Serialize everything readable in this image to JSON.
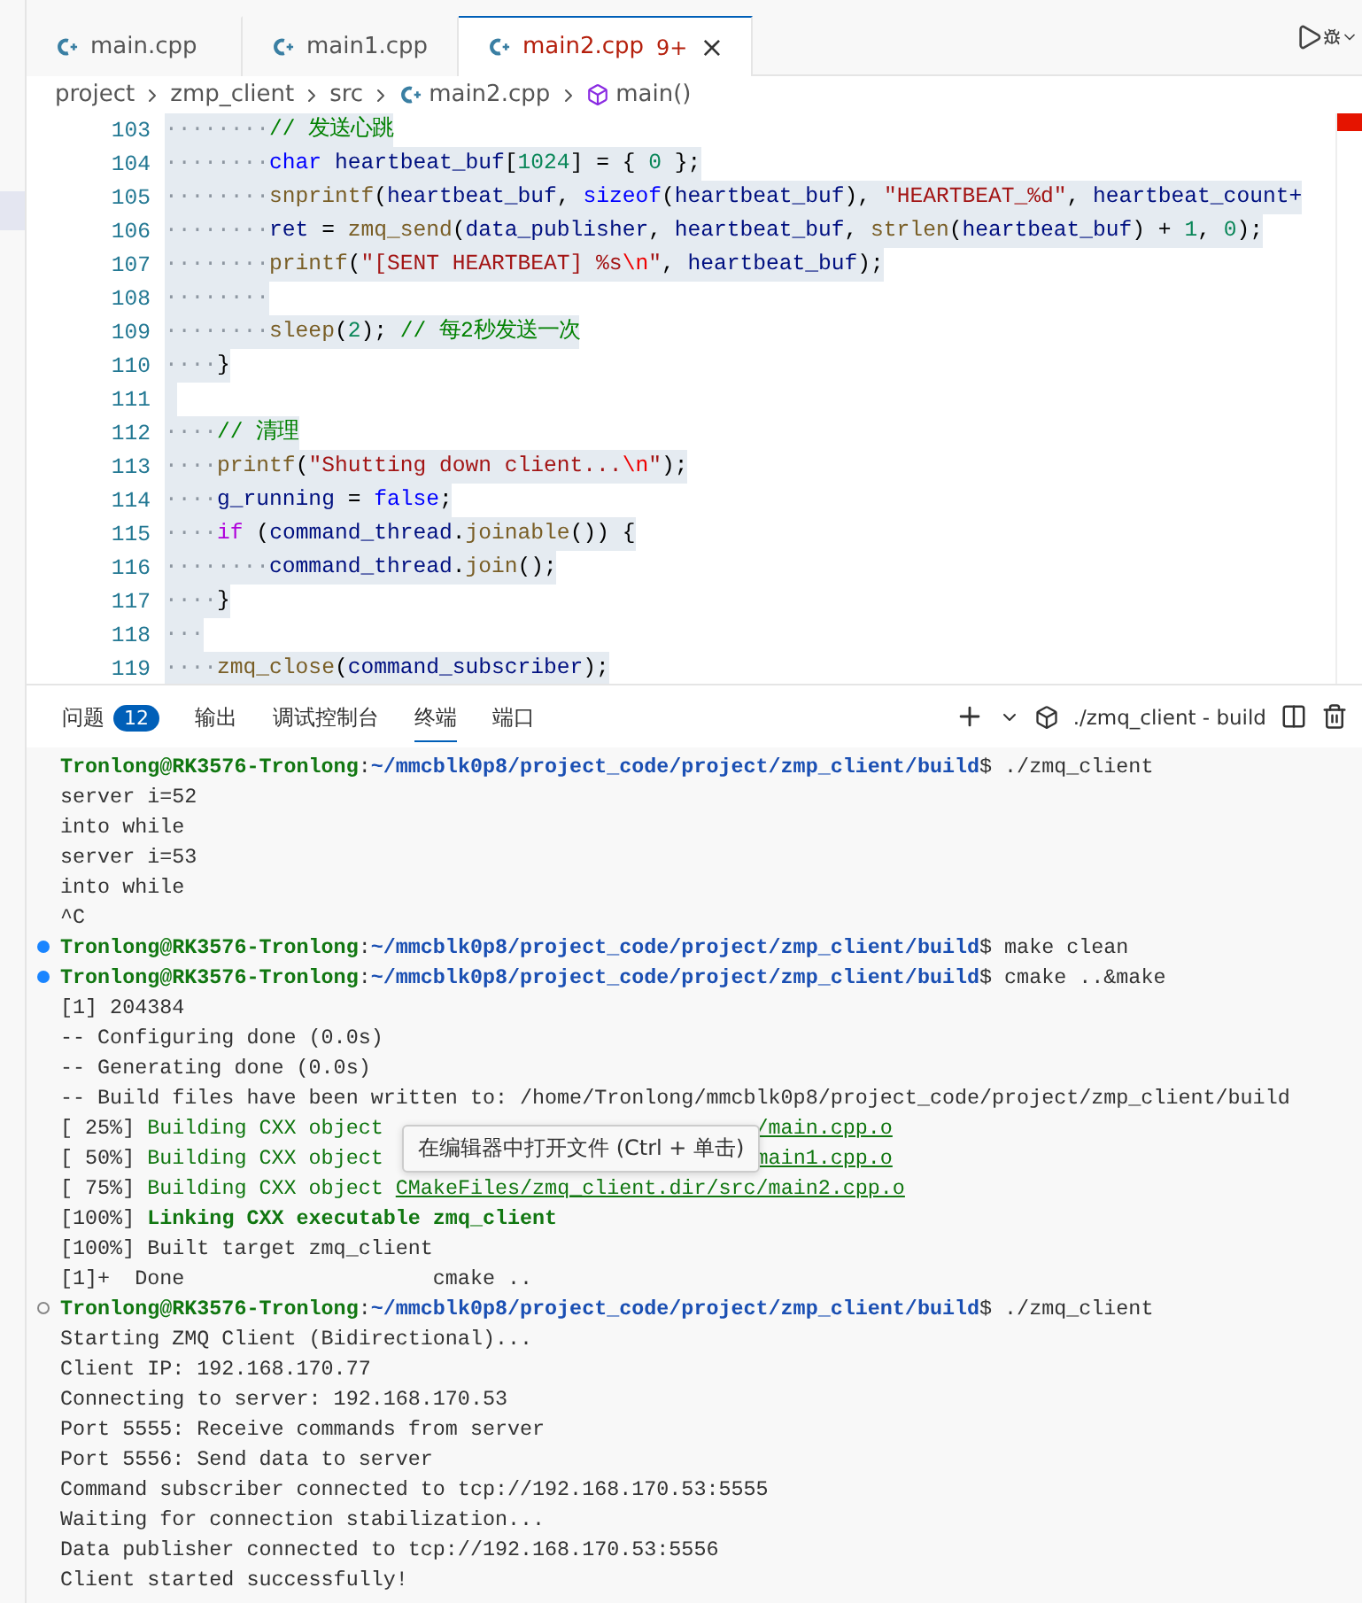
{
  "editor_tabs": [
    {
      "label": "main.cpp",
      "selected": false
    },
    {
      "label": "main1.cpp",
      "selected": false
    },
    {
      "label": "main2.cpp",
      "selected": true,
      "badge": "9+",
      "close": "×"
    }
  ],
  "breadcrumb": [
    "project",
    "zmp_client",
    "src",
    "main2.cpp",
    "main()"
  ],
  "code_lines": [
    {
      "n": "103",
      "selected": true,
      "t": [
        {
          "kind": "ws",
          "text": "········"
        },
        {
          "kind": "cmt",
          "text": "// 发送心跳"
        }
      ]
    },
    {
      "n": "104",
      "selected": true,
      "t": [
        {
          "kind": "ws",
          "text": "········"
        },
        {
          "kind": "kw",
          "text": "char"
        },
        {
          "kind": "var",
          "text": " heartbeat_buf"
        },
        {
          "kind": "p",
          "text": "["
        },
        {
          "kind": "num",
          "text": "1024"
        },
        {
          "kind": "p",
          "text": "] = { "
        },
        {
          "kind": "num",
          "text": "0"
        },
        {
          "kind": "p",
          "text": " };"
        }
      ]
    },
    {
      "n": "105",
      "selected": true,
      "t": [
        {
          "kind": "ws",
          "text": "········"
        },
        {
          "kind": "fn",
          "text": "snprintf"
        },
        {
          "kind": "p",
          "text": "("
        },
        {
          "kind": "var",
          "text": "heartbeat_buf"
        },
        {
          "kind": "p",
          "text": ", "
        },
        {
          "kind": "kw",
          "text": "sizeof"
        },
        {
          "kind": "p",
          "text": "("
        },
        {
          "kind": "var",
          "text": "heartbeat_buf"
        },
        {
          "kind": "p",
          "text": "), "
        },
        {
          "kind": "str",
          "text": "\"HEARTBEAT_%d\""
        },
        {
          "kind": "p",
          "text": ", "
        },
        {
          "kind": "var",
          "text": "heartbeat_count+"
        }
      ]
    },
    {
      "n": "106",
      "selected": true,
      "t": [
        {
          "kind": "ws",
          "text": "········"
        },
        {
          "kind": "var",
          "text": "ret"
        },
        {
          "kind": "p",
          "text": " = "
        },
        {
          "kind": "fn",
          "text": "zmq_send"
        },
        {
          "kind": "p",
          "text": "("
        },
        {
          "kind": "var",
          "text": "data_publisher"
        },
        {
          "kind": "p",
          "text": ", "
        },
        {
          "kind": "var",
          "text": "heartbeat_buf"
        },
        {
          "kind": "p",
          "text": ", "
        },
        {
          "kind": "fn",
          "text": "strlen"
        },
        {
          "kind": "p",
          "text": "("
        },
        {
          "kind": "var",
          "text": "heartbeat_buf"
        },
        {
          "kind": "p",
          "text": ") + "
        },
        {
          "kind": "num",
          "text": "1"
        },
        {
          "kind": "p",
          "text": ", "
        },
        {
          "kind": "num",
          "text": "0"
        },
        {
          "kind": "p",
          "text": ");"
        }
      ]
    },
    {
      "n": "107",
      "selected": true,
      "t": [
        {
          "kind": "ws",
          "text": "········"
        },
        {
          "kind": "fn",
          "text": "printf"
        },
        {
          "kind": "p",
          "text": "("
        },
        {
          "kind": "str",
          "text": "\"[SENT HEARTBEAT] %s"
        },
        {
          "kind": "esc",
          "text": "\\n"
        },
        {
          "kind": "str",
          "text": "\""
        },
        {
          "kind": "p",
          "text": ", "
        },
        {
          "kind": "var",
          "text": "heartbeat_buf"
        },
        {
          "kind": "p",
          "text": ");"
        }
      ]
    },
    {
      "n": "108",
      "selected": true,
      "t": [
        {
          "kind": "ws",
          "text": "········"
        }
      ]
    },
    {
      "n": "109",
      "selected": true,
      "t": [
        {
          "kind": "ws",
          "text": "········"
        },
        {
          "kind": "fn",
          "text": "sleep"
        },
        {
          "kind": "p",
          "text": "("
        },
        {
          "kind": "num",
          "text": "2"
        },
        {
          "kind": "p",
          "text": "); "
        },
        {
          "kind": "cmt",
          "text": "// 每2秒发送一次"
        }
      ]
    },
    {
      "n": "110",
      "selected": true,
      "t": [
        {
          "kind": "ws",
          "text": "····"
        },
        {
          "kind": "p",
          "text": "}"
        }
      ]
    },
    {
      "n": "111",
      "selected": true
    },
    {
      "n": "112",
      "selected": true,
      "t": [
        {
          "kind": "ws",
          "text": "····"
        },
        {
          "kind": "cmt",
          "text": "// 清理"
        }
      ]
    },
    {
      "n": "113",
      "selected": true,
      "t": [
        {
          "kind": "ws",
          "text": "····"
        },
        {
          "kind": "fn",
          "text": "printf"
        },
        {
          "kind": "p",
          "text": "("
        },
        {
          "kind": "str",
          "text": "\"Shutting down client..."
        },
        {
          "kind": "esc",
          "text": "\\n"
        },
        {
          "kind": "str",
          "text": "\""
        },
        {
          "kind": "p",
          "text": ");"
        }
      ]
    },
    {
      "n": "114",
      "selected": true,
      "t": [
        {
          "kind": "ws",
          "text": "····"
        },
        {
          "kind": "var",
          "text": "g_running"
        },
        {
          "kind": "p",
          "text": " = "
        },
        {
          "kind": "kw",
          "text": "false"
        },
        {
          "kind": "p",
          "text": ";"
        }
      ]
    },
    {
      "n": "115",
      "selected": true,
      "t": [
        {
          "kind": "ws",
          "text": "····"
        },
        {
          "kind": "ctl",
          "text": "if"
        },
        {
          "kind": "p",
          "text": " ("
        },
        {
          "kind": "var",
          "text": "command_thread"
        },
        {
          "kind": "p",
          "text": "."
        },
        {
          "kind": "fn",
          "text": "joinable"
        },
        {
          "kind": "p",
          "text": "()) {"
        }
      ]
    },
    {
      "n": "116",
      "selected": true,
      "t": [
        {
          "kind": "ws",
          "text": "········"
        },
        {
          "kind": "var",
          "text": "command_thread"
        },
        {
          "kind": "p",
          "text": "."
        },
        {
          "kind": "fn",
          "text": "join"
        },
        {
          "kind": "p",
          "text": "();"
        }
      ]
    },
    {
      "n": "117",
      "selected": true,
      "t": [
        {
          "kind": "ws",
          "text": "····"
        },
        {
          "kind": "p",
          "text": "}"
        }
      ]
    },
    {
      "n": "118",
      "selected": true,
      "t": [
        {
          "kind": "ws",
          "text": "···"
        }
      ]
    },
    {
      "n": "119",
      "selected": true,
      "t": [
        {
          "kind": "ws",
          "text": "····"
        },
        {
          "kind": "fn",
          "text": "zmq_close"
        },
        {
          "kind": "p",
          "text": "("
        },
        {
          "kind": "var",
          "text": "command_subscriber"
        },
        {
          "kind": "p",
          "text": ");"
        }
      ]
    }
  ],
  "panel_tabs": [
    {
      "label": "问题",
      "badge": "12",
      "selected": false
    },
    {
      "label": "输出",
      "selected": false
    },
    {
      "label": "调试控制台",
      "selected": false
    },
    {
      "label": "终端",
      "selected": true
    },
    {
      "label": "端口",
      "selected": false
    }
  ],
  "terminal_name": "./zmq_client - build",
  "terminal": [
    {
      "kind": "prompt",
      "user": "Tronlong@RK3576-Tronlong",
      "sep": ":",
      "path": "~/mmcblk0p8/project_code/project/zmp_client/build",
      "cmd": "$ ./zmq_client"
    },
    {
      "kind": "text",
      "text": "server i=52"
    },
    {
      "kind": "text",
      "text": "into while"
    },
    {
      "kind": "text",
      "text": "server i=53"
    },
    {
      "kind": "text",
      "text": "into while"
    },
    {
      "kind": "text",
      "text": "^C"
    },
    {
      "kind": "prompt_done",
      "user": "Tronlong@RK3576-Tronlong",
      "sep": ":",
      "path": "~/mmcblk0p8/project_code/project/zmp_client/build",
      "cmd": "$ make clean"
    },
    {
      "kind": "prompt_done",
      "user": "Tronlong@RK3576-Tronlong",
      "sep": ":",
      "path": "~/mmcblk0p8/project_code/project/zmp_client/build",
      "cmd": "$ cmake ..&make"
    },
    {
      "kind": "text",
      "text": "[1] 204384"
    },
    {
      "kind": "text",
      "text": "-- Configuring done (0.0s)"
    },
    {
      "kind": "text",
      "text": "-- Generating done (0.0s)"
    },
    {
      "kind": "text",
      "text": "-- Build files have been written to: /home/Tronlong/mmcblk0p8/project_code/project/zmp_client/build"
    },
    {
      "kind": "build",
      "pct": "[ 25%]",
      "action": "Building CXX object",
      "link": "/main.cpp.o",
      "covered": true,
      "tooltip": "在编辑器中打开文件 (Ctrl + 单击)"
    },
    {
      "kind": "build",
      "pct": "[ 50%]",
      "action": "Building CXX object",
      "link": "main1.cpp.o",
      "covered": true
    },
    {
      "kind": "build",
      "pct": "[ 75%]",
      "action": "Building CXX object",
      "link": "CMakeFiles/zmq_client.dir/src/main2.cpp.o",
      "covered": false
    },
    {
      "kind": "link",
      "pct": "[100%]",
      "action": "Linking CXX executable zmq_client"
    },
    {
      "kind": "text",
      "text": "[100%] Built target zmq_client"
    },
    {
      "kind": "text",
      "text": "[1]+  Done                    cmake .."
    },
    {
      "kind": "prompt_running",
      "user": "Tronlong@RK3576-Tronlong",
      "sep": ":",
      "path": "~/mmcblk0p8/project_code/project/zmp_client/build",
      "cmd": "$ ./zmq_client"
    },
    {
      "kind": "text",
      "text": "Starting ZMQ Client (Bidirectional)..."
    },
    {
      "kind": "text",
      "text": "Client IP: 192.168.170.77"
    },
    {
      "kind": "text",
      "text": "Connecting to server: 192.168.170.53"
    },
    {
      "kind": "text",
      "text": "Port 5555: Receive commands from server"
    },
    {
      "kind": "text",
      "text": "Port 5556: Send data to server"
    },
    {
      "kind": "text",
      "text": "Command subscriber connected to tcp://192.168.170.53:5555"
    },
    {
      "kind": "text",
      "text": "Waiting for connection stabilization..."
    },
    {
      "kind": "text",
      "text": "Data publisher connected to tcp://192.168.170.53:5556"
    },
    {
      "kind": "text",
      "text": "Client started successfully!"
    }
  ]
}
